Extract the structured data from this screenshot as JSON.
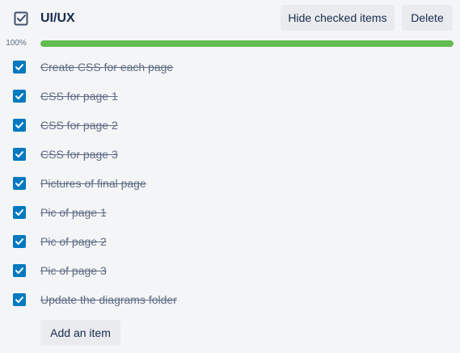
{
  "checklist": {
    "title": "UI/UX",
    "title_icon": "checklist-icon",
    "hide_checked_label": "Hide checked items",
    "delete_label": "Delete",
    "progress_label": "100%",
    "progress_fraction": 1.0,
    "progress_color": "#61bd4f",
    "checkbox_color": "#0079bf",
    "items": [
      {
        "label": "Create CSS for each page",
        "checked": true
      },
      {
        "label": "CSS for page 1",
        "checked": true
      },
      {
        "label": "CSS for page 2",
        "checked": true
      },
      {
        "label": "CSS for page 3",
        "checked": true
      },
      {
        "label": "Pictures of final page",
        "checked": true
      },
      {
        "label": "Pic of page 1",
        "checked": true
      },
      {
        "label": "Pic of page 2",
        "checked": true
      },
      {
        "label": "Pic of page 3",
        "checked": true
      },
      {
        "label": "Update the diagrams folder",
        "checked": true
      }
    ],
    "add_item_label": "Add an item"
  }
}
